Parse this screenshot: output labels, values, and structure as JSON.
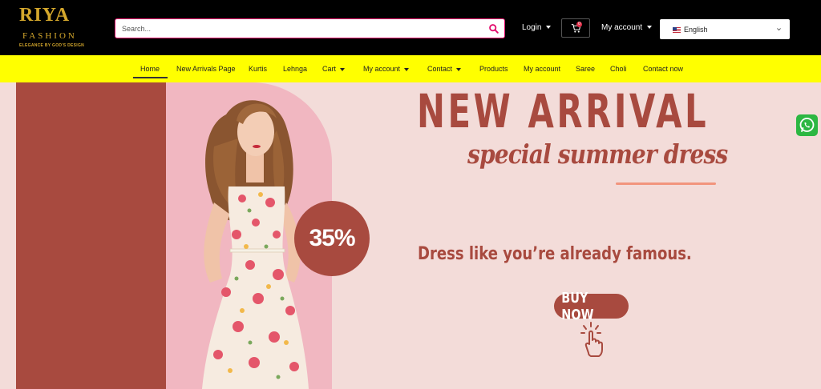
{
  "brand": {
    "logo_main": "RIYA",
    "logo_sub": "FASHION",
    "tagline": "ELEGANCE BY GOD'S DESIGN"
  },
  "header": {
    "search_placeholder": "Search...",
    "login_label": "Login",
    "cart_count": "0",
    "account_label": "My account",
    "language_label": "English"
  },
  "nav": {
    "items": [
      {
        "label": "Home",
        "active": true
      },
      {
        "label": "New Arrivals Page"
      },
      {
        "label": "Kurtis"
      },
      {
        "label": "Lehnga"
      },
      {
        "label": "Cart",
        "dropdown": true
      },
      {
        "label": "My account",
        "dropdown": true
      },
      {
        "label": "Contact",
        "dropdown": true
      },
      {
        "label": "Products"
      },
      {
        "label": "My account"
      },
      {
        "label": "Saree"
      },
      {
        "label": "Choli"
      },
      {
        "label": "Contact now"
      }
    ]
  },
  "hero": {
    "headline": "NEW ARRIVAL",
    "subhead": "special summer dress",
    "discount": "35%",
    "tagline": "Dress like you’re already famous.",
    "cta": "BUY NOW"
  },
  "colors": {
    "accent": "#a84a3f",
    "hero_bg": "#f3dcd9",
    "nav_bg": "#ffff00",
    "search_border": "#e2076a",
    "whatsapp": "#2cb742"
  }
}
